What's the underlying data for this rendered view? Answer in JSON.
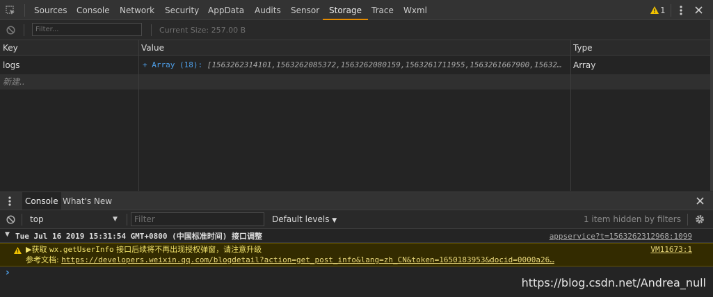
{
  "tabs": [
    "Sources",
    "Console",
    "Network",
    "Security",
    "AppData",
    "Audits",
    "Sensor",
    "Storage",
    "Trace",
    "Wxml"
  ],
  "active_tab": "Storage",
  "warning_count": "1",
  "storage": {
    "filter_placeholder": "Filter...",
    "current_size": "Current Size:  257.00 B",
    "headers": {
      "key": "Key",
      "value": "Value",
      "type": "Type"
    },
    "rows": [
      {
        "key": "logs",
        "value_prefix": "+ Array (18): ",
        "value": "[1563262314101,1563262085372,1563262080159,1563261711955,1563261667900,15632…",
        "type": "Array"
      }
    ],
    "new_row": "新建.."
  },
  "drawer": {
    "tabs": [
      "Console",
      "What's New"
    ],
    "active_tab": "Console"
  },
  "console": {
    "context": "top",
    "filter_placeholder": "Filter",
    "levels": "Default levels",
    "hidden": "1 item hidden by filters",
    "group": {
      "title": "Tue Jul 16 2019 15:31:54 GMT+0800 (中国标准时间) 接口调整",
      "source": "appservice?t=1563262312968:1099"
    },
    "warning": {
      "line1_prefix": "▶获取 ",
      "line1_code": "wx.getUserInfo",
      "line1_suffix": " 接口后续将不再出现授权弹窗，请注意升级",
      "line2_label": "参考文档: ",
      "line2_link": "https://developers.weixin.qq.com/blogdetail?action=get_post_info&lang=zh_CN&token=1650183953&docid=0000a26…",
      "source": "VM11673:1"
    },
    "prompt": "›"
  },
  "watermark": "https://blog.csdn.net/Andrea_null",
  "colors": {
    "accent": "#e68c00",
    "link": "#4e9fe8",
    "warning_bg": "#332b00",
    "warning_text": "#f2e36b"
  }
}
